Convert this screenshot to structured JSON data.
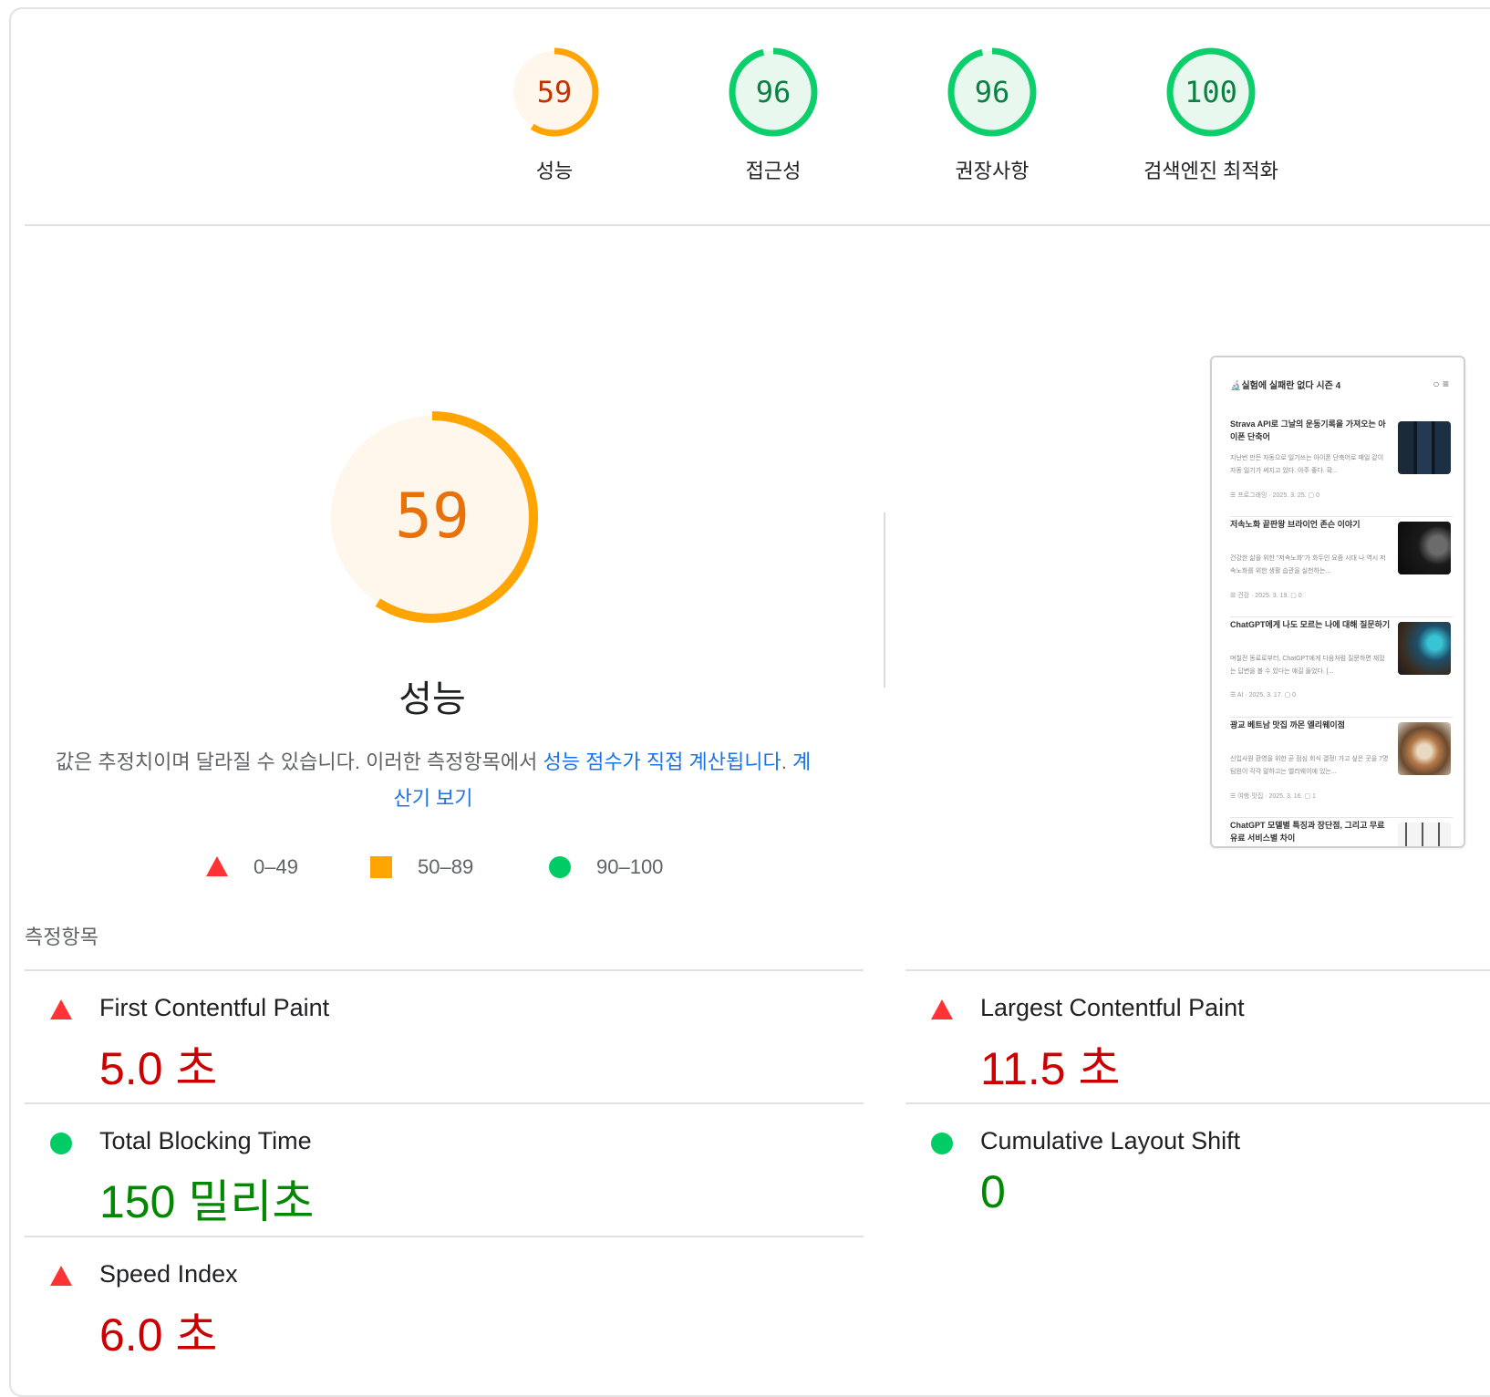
{
  "categories": [
    {
      "score": "59",
      "label": "성능",
      "value": 59,
      "color": "#ffa400",
      "fill": "#fff6ec",
      "status": "orange"
    },
    {
      "score": "96",
      "label": "접근성",
      "value": 96,
      "color": "#0cce6b",
      "fill": "#e8f8ef",
      "status": "green"
    },
    {
      "score": "96",
      "label": "권장사항",
      "value": 96,
      "color": "#0cce6b",
      "fill": "#e8f8ef",
      "status": "green"
    },
    {
      "score": "100",
      "label": "검색엔진 최적화",
      "value": 100,
      "color": "#0cce6b",
      "fill": "#e8f8ef",
      "status": "green"
    }
  ],
  "performance": {
    "score": "59",
    "value": 59,
    "title": "성능",
    "desc_prefix": "값은 추정치이며 달라질 수 있습니다. 이러한 측정항목에서 ",
    "desc_link": "성능 점수가 직접 계산됩니다",
    "desc_mid": ". ",
    "desc_link2": "계산기 보기"
  },
  "legend": [
    {
      "icon": "triangle-icon",
      "range": "0–49"
    },
    {
      "icon": "square-icon",
      "range": "50–89"
    },
    {
      "icon": "circle-icon",
      "range": "90–100"
    }
  ],
  "thumbnail": {
    "blog_title": "🔬실험에 실패란 없다 시즌 4",
    "header_icons": "○ ≡",
    "posts": [
      {
        "title": "Strava API로 그날의 운동기록을 가져오는 아이폰 단축어",
        "body": "지난번 만든 자동으로 일기쓰는 아이폰 단축어로 매일 같이 자동 일기가 써지고 있다. 아주 좋다. 확...",
        "meta": "☰ 프로그래밍 · 2025. 3. 25. ▢ 0"
      },
      {
        "title": "저속노화 끝판왕 브라이언 존슨 이야기",
        "body": "건강한 삶을 위한 \"저속노화\"가 화두인 요즘 시대 나 역시 저속노화를 위한 생활 습관을 실천하는...",
        "meta": "☰ 건강 · 2025. 3. 19. ▢ 0"
      },
      {
        "title": "ChatGPT에게 나도 모르는 나에 대해 질문하기",
        "body": "며칠전 동료로부터, ChatGPT에게 다음처럼 질문하면 재밌는 답변을 볼 수 있다는 얘길 들었다. [...",
        "meta": "☰ AI · 2025. 3. 17. ▢ 0"
      },
      {
        "title": "광교 베트남 맛집 까몬 엘리웨이점",
        "body": "신입사원 환영을 위한 곧 점심 회식 결정! 가고 싶은 곳을 7명 팀원이 각각 말하고는 엘리웨이에 있는...",
        "meta": "☰ 여행·맛집 · 2025. 3. 16. ▢ 1"
      },
      {
        "title": "ChatGPT 모델별 특징과 장단점, 그리고 무료 유료 서비스별 차이",
        "body": "",
        "meta": ""
      }
    ]
  },
  "metrics_heading": "측정항목",
  "metrics": [
    {
      "name": "First Contentful Paint",
      "value": "5.0 초",
      "status": "red"
    },
    {
      "name": "Largest Contentful Paint",
      "value": "11.5 초",
      "status": "red"
    },
    {
      "name": "Total Blocking Time",
      "value": "150 밀리초",
      "status": "green"
    },
    {
      "name": "Cumulative Layout Shift",
      "value": "0",
      "status": "green"
    },
    {
      "name": "Speed Index",
      "value": "6.0 초",
      "status": "red"
    }
  ]
}
